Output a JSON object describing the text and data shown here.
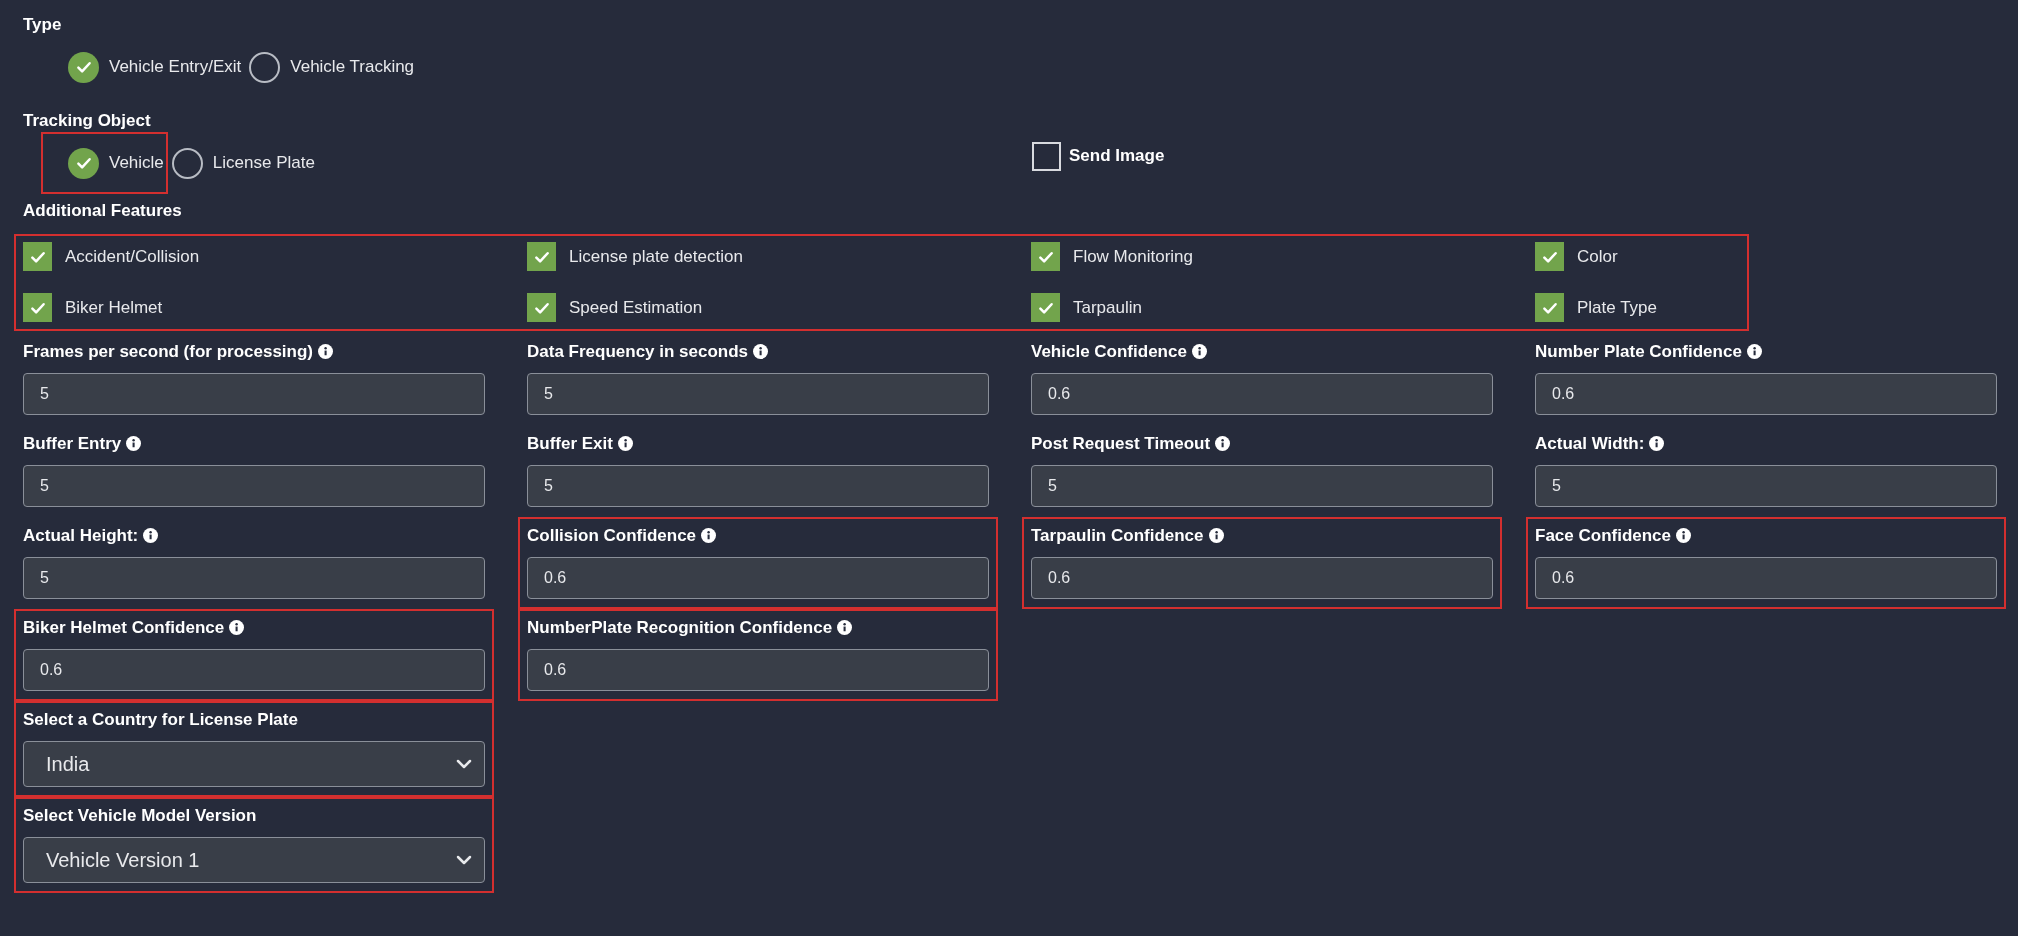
{
  "type": {
    "label": "Type",
    "options": [
      {
        "label": "Vehicle Entry/Exit",
        "selected": true,
        "highlighted": false
      },
      {
        "label": "Vehicle Tracking",
        "selected": false,
        "highlighted": false
      }
    ]
  },
  "tracking_object": {
    "label": "Tracking Object",
    "options": [
      {
        "label": "Vehicle",
        "selected": true,
        "highlighted": true
      },
      {
        "label": "License Plate",
        "selected": false,
        "highlighted": false
      }
    ]
  },
  "send_image": {
    "label": "Send Image",
    "checked": false
  },
  "additional_features": {
    "label": "Additional Features",
    "highlighted": true,
    "items": [
      {
        "label": "Accident/Collision",
        "checked": true
      },
      {
        "label": "License plate detection",
        "checked": true
      },
      {
        "label": "Flow Monitoring",
        "checked": true
      },
      {
        "label": "Color",
        "checked": true
      },
      {
        "label": "Biker Helmet",
        "checked": true
      },
      {
        "label": "Speed Estimation",
        "checked": true
      },
      {
        "label": "Tarpaulin",
        "checked": true
      },
      {
        "label": "Plate Type",
        "checked": true
      }
    ]
  },
  "field_rows": [
    [
      {
        "kind": "input",
        "label": "Frames per second (for processing)",
        "info": true,
        "value": "5",
        "highlighted": false
      },
      {
        "kind": "input",
        "label": "Data Frequency in seconds",
        "info": true,
        "value": "5",
        "highlighted": false
      },
      {
        "kind": "input",
        "label": "Vehicle Confidence",
        "info": true,
        "value": "0.6",
        "highlighted": false
      },
      {
        "kind": "input",
        "label": "Number Plate Confidence",
        "info": true,
        "value": "0.6",
        "highlighted": false
      }
    ],
    [
      {
        "kind": "input",
        "label": "Buffer Entry",
        "info": true,
        "value": "5",
        "highlighted": false
      },
      {
        "kind": "input",
        "label": "Buffer Exit",
        "info": true,
        "value": "5",
        "highlighted": false
      },
      {
        "kind": "input",
        "label": "Post Request Timeout",
        "info": true,
        "value": "5",
        "highlighted": false
      },
      {
        "kind": "input",
        "label": "Actual Width:",
        "info": true,
        "value": "5",
        "highlighted": false
      }
    ],
    [
      {
        "kind": "input",
        "label": "Actual Height:",
        "info": true,
        "value": "5",
        "highlighted": false
      },
      {
        "kind": "input",
        "label": "Collision Confidence",
        "info": true,
        "value": "0.6",
        "highlighted": true
      },
      {
        "kind": "input",
        "label": "Tarpaulin Confidence",
        "info": true,
        "value": "0.6",
        "highlighted": true
      },
      {
        "kind": "input",
        "label": "Face Confidence",
        "info": true,
        "value": "0.6",
        "highlighted": true
      }
    ],
    [
      {
        "kind": "input",
        "label": "Biker Helmet Confidence",
        "info": true,
        "value": "0.6",
        "highlighted": true
      },
      {
        "kind": "input",
        "label": "NumberPlate Recognition Confidence",
        "info": true,
        "value": "0.6",
        "highlighted": true
      }
    ],
    [
      {
        "kind": "select",
        "label": "Select a Country for License Plate",
        "info": false,
        "value": "India",
        "highlighted": true
      }
    ],
    [
      {
        "kind": "select",
        "label": "Select Vehicle Model Version",
        "info": false,
        "value": "Vehicle Version 1",
        "highlighted": true
      }
    ]
  ]
}
